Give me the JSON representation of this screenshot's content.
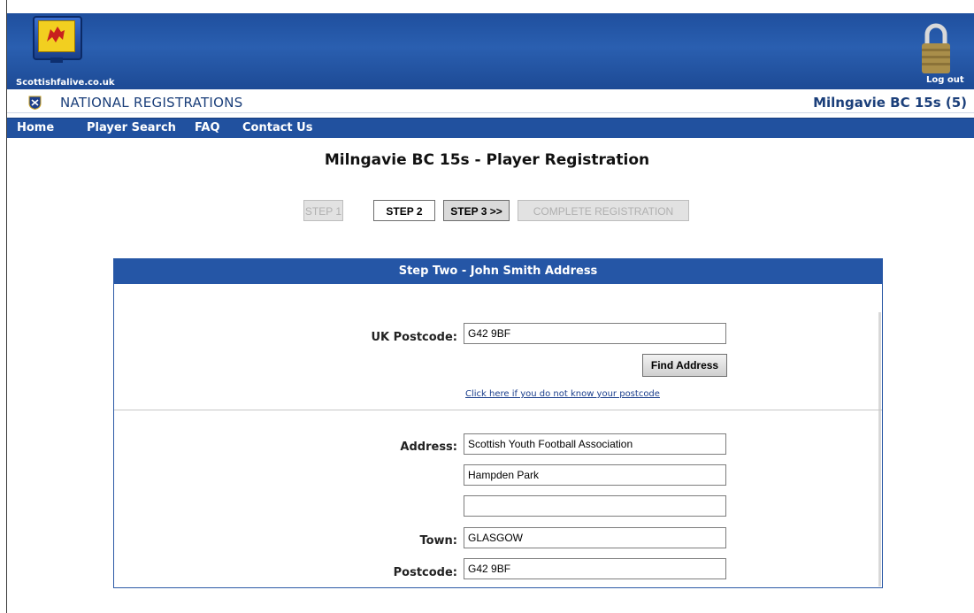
{
  "header": {
    "site_name": "Scottishfalive.co.uk",
    "logout_label": "Log out",
    "section_title": "NATIONAL REGISTRATIONS",
    "team_label": "Milngavie BC 15s (5)"
  },
  "nav": {
    "items": [
      "Home",
      "Player Search",
      "FAQ",
      "Contact Us"
    ]
  },
  "page": {
    "title": "Milngavie BC 15s - Player Registration"
  },
  "steps": {
    "step1": "STEP 1",
    "step2": "STEP 2",
    "step3": "STEP 3 >>",
    "complete": "COMPLETE REGISTRATION"
  },
  "panel": {
    "heading": "Step Two - John Smith Address",
    "postcode_label": "UK Postcode:",
    "postcode_value": "G42 9BF",
    "find_button": "Find Address",
    "postcode_help_link": "Click here if you do not know your postcode",
    "address_label": "Address:",
    "address_line1": "Scottish Youth Football Association",
    "address_line2": "Hampden Park",
    "address_line3": "",
    "town_label": "Town:",
    "town_value": "GLASGOW",
    "postcode2_label": "Postcode:",
    "postcode2_value": "G42 9BF"
  },
  "colors": {
    "banner_blue": "#2a5fb0",
    "nav_blue": "#21519f",
    "title_text": "#1b3f7a"
  }
}
